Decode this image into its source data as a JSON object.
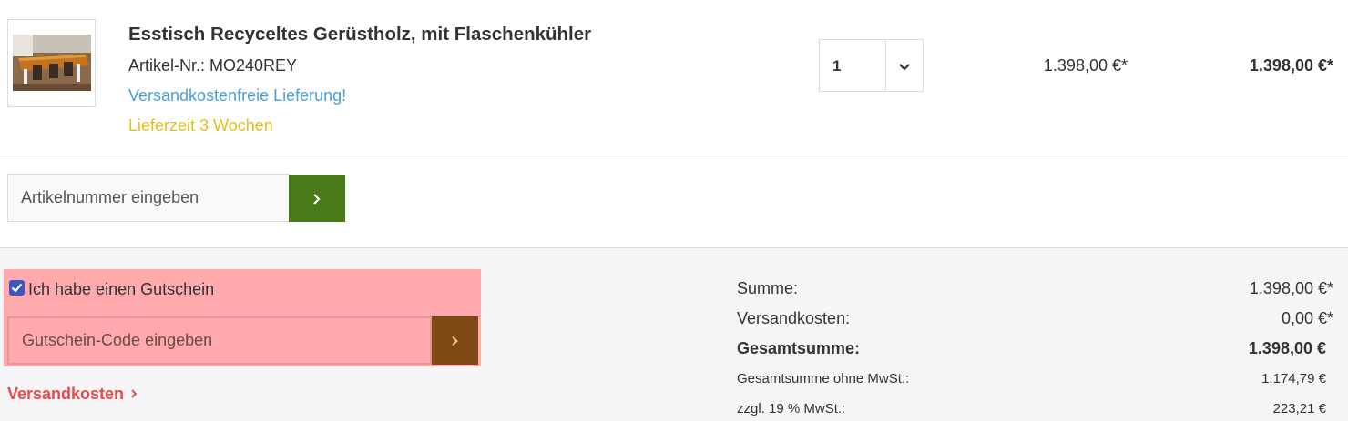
{
  "cart_item": {
    "title": "Esstisch Recyceltes Gerüstholz, mit Flaschenkühler",
    "article_number": "Artikel-Nr.: MO240REY",
    "shipping_note": "Versandkostenfreie Lieferung!",
    "delivery_time": "Lieferzeit 3 Wochen",
    "quantity": "1",
    "unit_price": "1.398,00 €*",
    "total_price": "1.398,00 €*"
  },
  "article_entry": {
    "placeholder": "Artikelnummer eingeben"
  },
  "voucher": {
    "checkbox_label": "Ich habe einen Gutschein",
    "checked": true,
    "placeholder": "Gutschein-Code eingeben"
  },
  "shipping_link": "Versandkosten",
  "summary": {
    "rows": [
      {
        "label": "Summe:",
        "value": "1.398,00 €*"
      },
      {
        "label": "Versandkosten:",
        "value": "0,00 €*"
      },
      {
        "label": "Gesamtsumme:",
        "value": "1.398,00 €"
      },
      {
        "label": "Gesamtsumme ohne MwSt.:",
        "value": "1.174,79 €"
      },
      {
        "label": "zzgl. 19 % MwSt.:",
        "value": "223,21 €"
      }
    ]
  },
  "colors": {
    "accent_green": "#4a7a17",
    "link_blue": "#4a9fd8",
    "delivery_yellow": "#e3bf1e",
    "link_red": "#e84a4a",
    "voucher_highlight": "#ffaaad",
    "voucher_button": "#7d4a14"
  },
  "icons": {
    "qty_dropdown": "chevron-down-icon",
    "submit": "chevron-right-icon",
    "voucher_submit": "chevron-right-icon",
    "shipping_link": "chevron-right-icon"
  }
}
